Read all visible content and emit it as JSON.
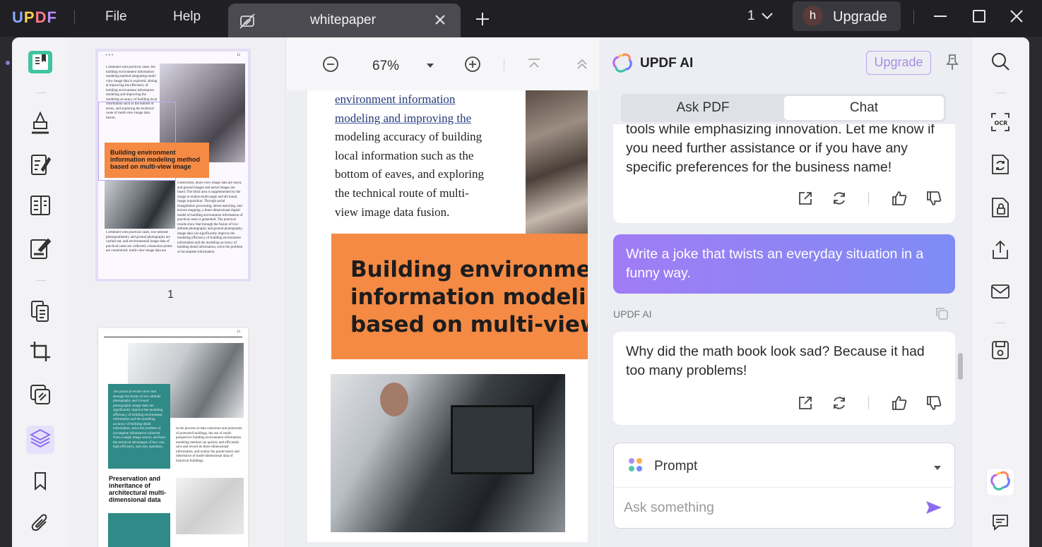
{
  "titlebar": {
    "logo": [
      "U",
      "P",
      "D",
      "F"
    ],
    "menu": {
      "file": "File",
      "help": "Help"
    },
    "tab_title": "whitepaper",
    "page_number": "1",
    "avatar_letter": "h",
    "upgrade_label": "Upgrade"
  },
  "viewer": {
    "zoom": "67%",
    "body_lines": [
      "environment information",
      "modeling and improving the",
      "modeling accuracy of building",
      "local information such as the",
      "bottom of eaves, and exploring",
      "the technical route of multi-",
      "view image data fusion."
    ],
    "heading_lines": [
      "Building environment",
      "information modeling",
      "based on multi-view i"
    ]
  },
  "thumbnails": {
    "page1_label": "1",
    "page1_header_right": "12",
    "page1_header_left": "● ● ●",
    "page1_text_a": "Combined with practical cases, the building environment information modeling method integrating multi-view image data is explored, aiming at improving the efficiency of building environment information modeling and improving the modeling accuracy of building local information such as the bottom of eaves, and exploring the technical route of multi-view image data fusion.",
    "page1_heading": "Building environment information modeling method based on multi-view image",
    "page1_text_b": "constructed, multi-view image data are fused, and ground images and aerial images are fused. The blind area is supplemented by the image to realize multi-angle and all-round image acquisition. Through aerial triangulation processing, dense matching, and texture mapping, a three-dimensional digital model of building environment information of practical cases is generated. The practical results show that through the fusion of low-altitude photography and ground photography, image data can significantly improve the modeling efficiency of building environment information and the modeling accuracy of building detail information, solve the problem of incomplete information",
    "page1_text_c": "Combined with practical cases, low-altitude photogrammetry and ground photography are carried out, and environmental image data of practical cases are collected; connection points are constructed, multi-view image data are",
    "page2_header_right": "13",
    "page2_teal_text": "The practical results show that through the fusion of low-altitude photography and Ground photographic image data can significantly improve the modeling efficiency of building environment information and the modeling accuracy of building detail information, solve the problem of incomplete information collected from a single image source, and have the technical advantages of low cost, high efficiency, and easy operation.",
    "page2_text": "In the process of data collection and protection of protected buildings, the use of multi-perspective building environment information modeling method can quickly and efficiently save and record its three-dimensional information, and realize the preservation and inheritance of multi-dimensional data of historical buildings.",
    "page2_heading": "Preservation and inheritance of architectural multi-dimensional data"
  },
  "ai": {
    "title": "UPDF AI",
    "upgrade_label": "Upgrade",
    "tabs": {
      "ask_pdf": "Ask PDF",
      "chat": "Chat"
    },
    "messages": {
      "prev_ai_lines": [
        "tools while emphasizing innovation. Let me know if",
        "you need further assistance or if you have any",
        "specific preferences for the business name!"
      ],
      "user_lines": [
        "Write a joke that twists an everyday situation in a",
        "funny way."
      ],
      "ai_label": "UPDF AI",
      "ai_reply_lines": [
        "Why did the math book look sad? Because it had",
        "too many problems!"
      ]
    },
    "prompt_label": "Prompt",
    "ask_placeholder": "Ask something"
  },
  "colors": {
    "accent": "#8b6cf0",
    "orange": "#f58a45",
    "teal": "#2f8a88",
    "titlebar": "#202024"
  }
}
